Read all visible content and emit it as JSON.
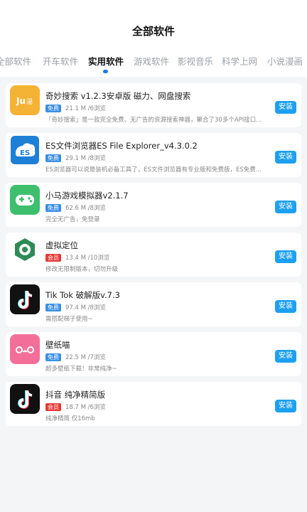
{
  "header": {
    "title": "全部软件"
  },
  "tabs": [
    {
      "label": "全部软件"
    },
    {
      "label": "开车软件"
    },
    {
      "label": "实用软件"
    },
    {
      "label": "游戏软件"
    },
    {
      "label": "影视音乐"
    },
    {
      "label": "科学上网"
    },
    {
      "label": "小说漫画"
    }
  ],
  "active_tab": 2,
  "colors": {
    "accent": "#1ea0f0",
    "tab_indicator": "#1a7be6",
    "free": "#3a8ee6",
    "paid": "#e53935"
  },
  "apps": [
    {
      "icon": "ju-icon",
      "name": "奇妙搜索 v1.2.3安卓版 磁力、网盘搜索",
      "badge": "免费",
      "size": "21.1 M /6浏览",
      "desc": "「奇妙搜索」是一款完全免费、无广告的资源搜索神器，聚合了30多个API接口...",
      "install": "安装"
    },
    {
      "icon": "es-file-explorer-icon",
      "name": "ES文件浏览器ES File Explorer_v4.3.0.2",
      "badge": "免费",
      "size": "29.1 M /8浏览",
      "desc": "ES浏览器可以说是装机必备工具了，ES文件浏览器有专业版和免费版，ES免费...",
      "install": "安装"
    },
    {
      "icon": "gamepad-icon",
      "name": "小马游戏模拟器v2.1.7",
      "badge": "免费",
      "size": "62.6 M /8浏览",
      "desc": "完全无广告，免登录",
      "install": "安装"
    },
    {
      "icon": "location-icon",
      "name": "虚拟定位",
      "badge": "会员",
      "size": "13.4 M /10浏览",
      "desc": "修改无限制版本，切勿升级",
      "install": "安装"
    },
    {
      "icon": "tiktok-icon",
      "name": "Tik Tok 破解版v.7.3",
      "badge": "免费",
      "size": "97.4 M /8浏览",
      "desc": "需搭配梯子使用~",
      "install": "安装"
    },
    {
      "icon": "wallpaper-face-icon",
      "name": "壁纸喵",
      "badge": "免费",
      "size": "22.5 M /7浏览",
      "desc": "超多壁纸下载！非常纯净~",
      "install": "安装"
    },
    {
      "icon": "douyin-icon",
      "name": "抖音 纯净精简版",
      "badge": "会员",
      "size": "18.7 M /6浏览",
      "desc": "纯净精简 仅16mb",
      "install": "安装"
    }
  ]
}
